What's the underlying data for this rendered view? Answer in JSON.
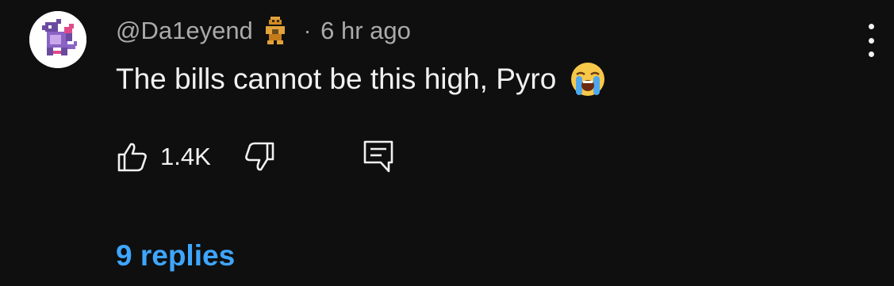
{
  "comment": {
    "author_handle": "@Da1eyend",
    "separator": "·",
    "timestamp": "6 hr ago",
    "text": "The bills cannot be this high, Pyro",
    "emoji": "loudly-crying-face",
    "likes": "1.4K",
    "replies_label": "9 replies"
  },
  "colors": {
    "background": "#0f0f0f",
    "text_primary": "#f1f1f1",
    "text_secondary": "#aaaaaa",
    "link": "#3ea6ff"
  },
  "icons": {
    "avatar": "pixel-dragon-avatar",
    "badge": "member-badge-icon",
    "menu": "more-vertical-icon",
    "like": "thumbs-up-icon",
    "dislike": "thumbs-down-icon",
    "reply": "reply-comment-icon"
  }
}
